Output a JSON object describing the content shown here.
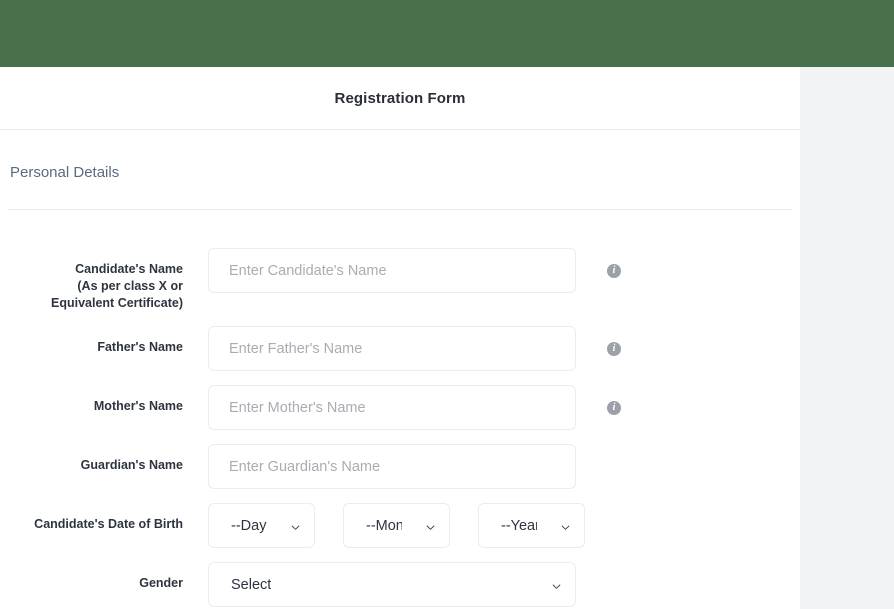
{
  "topbar": {
    "color": "#477048"
  },
  "card": {
    "title": "Registration Form"
  },
  "section": {
    "title": "Personal Details"
  },
  "fields": {
    "candidate_name": {
      "label_line1": "Candidate's Name",
      "label_line2": "(As per class X or",
      "label_line3": "Equivalent Certificate)",
      "placeholder": "Enter Candidate's Name",
      "value": "",
      "info": "i"
    },
    "father_name": {
      "label": "Father's Name",
      "placeholder": "Enter Father's Name",
      "value": "",
      "info": "i"
    },
    "mother_name": {
      "label": "Mother's Name",
      "placeholder": "Enter Mother's Name",
      "value": "",
      "info": "i"
    },
    "guardian_name": {
      "label": "Guardian's Name",
      "placeholder": "Enter Guardian's Name",
      "value": ""
    },
    "dob": {
      "label": "Candidate's Date of Birth",
      "day": "--Day",
      "month": "--Month",
      "year": "--Year"
    },
    "gender": {
      "label": "Gender",
      "value": "Select"
    }
  }
}
